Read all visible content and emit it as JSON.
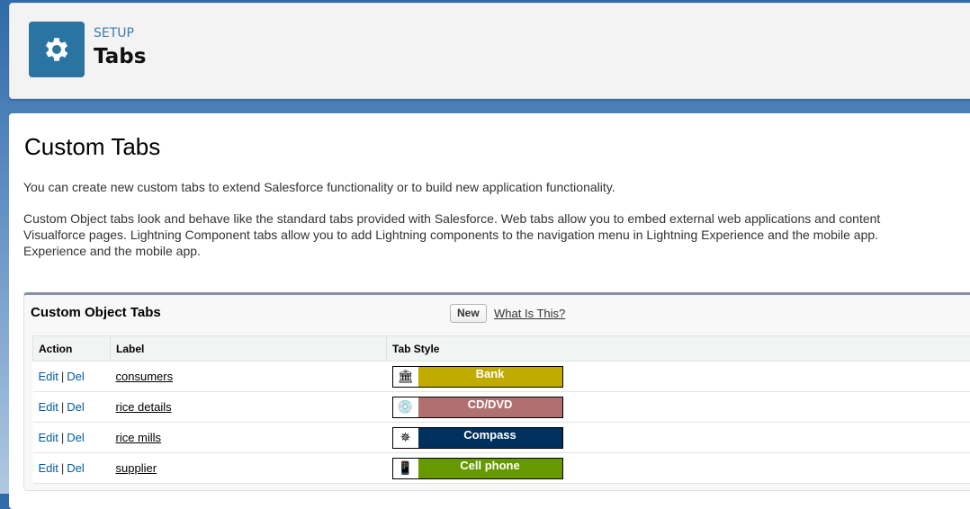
{
  "header": {
    "breadcrumb": "SETUP",
    "title": "Tabs",
    "icon": "gear-icon"
  },
  "page": {
    "title": "Custom Tabs",
    "intro": "You can create new custom tabs to extend Salesforce functionality or to build new application functionality.",
    "desc_lines": [
      "Custom Object tabs look and behave like the standard tabs provided with Salesforce. Web tabs allow you to embed external web applications and content",
      "Visualforce pages. Lightning Component tabs allow you to add Lightning components to the navigation menu in Lightning Experience and the mobile app.",
      "Experience and the mobile app."
    ]
  },
  "panel": {
    "title": "Custom Object Tabs",
    "new_label": "New",
    "help_link": "What Is This?",
    "columns": [
      "Action",
      "Label",
      "Tab Style"
    ],
    "edit": "Edit",
    "del": "Del",
    "sep": "|",
    "rows": [
      {
        "label": "consumers",
        "style": "Bank",
        "color": "#c0ac00",
        "icon": "bank-icon",
        "glyph": "🏛"
      },
      {
        "label": "rice details",
        "style": "CD/DVD",
        "color": "#b07070",
        "icon": "cd-icon",
        "glyph": "💿"
      },
      {
        "label": "rice mills",
        "style": "Compass",
        "color": "#00305e",
        "icon": "compass-icon",
        "glyph": "✵"
      },
      {
        "label": "supplier",
        "style": "Cell phone",
        "color": "#669900",
        "icon": "cell-phone-icon",
        "glyph": "📱"
      }
    ]
  }
}
